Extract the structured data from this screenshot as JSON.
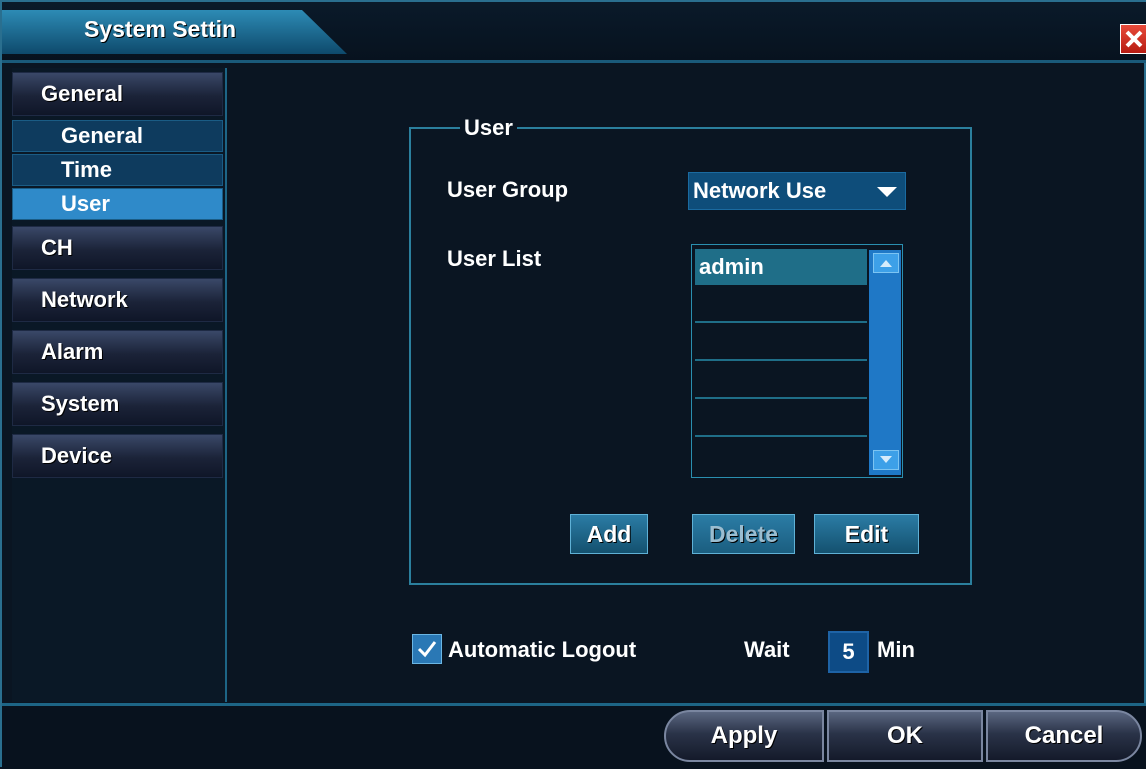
{
  "window": {
    "title": "System Settin"
  },
  "sidebar": {
    "items": [
      {
        "label": "General",
        "icon": null
      },
      {
        "label": "CH"
      },
      {
        "label": "Network"
      },
      {
        "label": "Alarm"
      },
      {
        "label": "System"
      },
      {
        "label": "Device"
      }
    ],
    "subitems": [
      {
        "label": "General"
      },
      {
        "label": "Time"
      },
      {
        "label": "User",
        "active": true
      }
    ]
  },
  "user_panel": {
    "legend": "User",
    "group_label": "User Group",
    "group_value": "Network Use",
    "list_label": "User List",
    "users": [
      "admin",
      "",
      "",
      "",
      "",
      ""
    ],
    "buttons": {
      "add": "Add",
      "delete": "Delete",
      "edit": "Edit"
    }
  },
  "logout": {
    "checkbox_label": "Automatic Logout",
    "checked": true,
    "wait_label": "Wait",
    "wait_value": "5",
    "unit": "Min"
  },
  "footer": {
    "apply": "Apply",
    "ok": "OK",
    "cancel": "Cancel"
  },
  "colors": {
    "accent": "#2f8ac9",
    "close": "#e84b3b"
  }
}
